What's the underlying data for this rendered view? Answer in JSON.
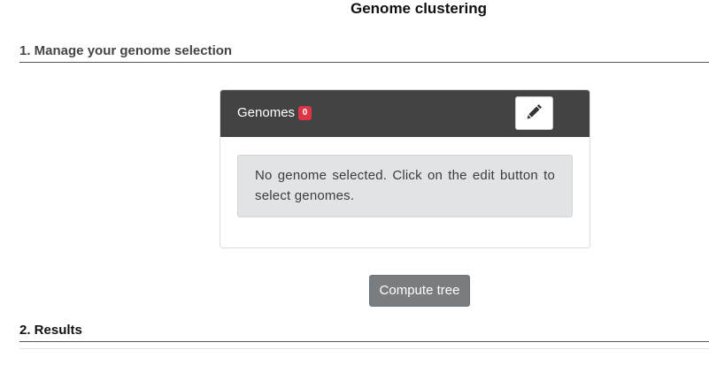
{
  "page": {
    "title": "Genome clustering"
  },
  "sections": {
    "selection_heading": "1. Manage your genome selection",
    "results_heading": "2. Results"
  },
  "genomes_card": {
    "title": "Genomes",
    "count_badge": "0",
    "edit_icon": "pencil-icon",
    "empty_message": "No genome selected. Click on the edit button to select genomes."
  },
  "actions": {
    "compute_label": "Compute tree"
  },
  "colors": {
    "card_header": "#434343",
    "badge": "#dc3545",
    "alert_bg": "#e2e3e5",
    "button_secondary": "#7a7d80"
  }
}
